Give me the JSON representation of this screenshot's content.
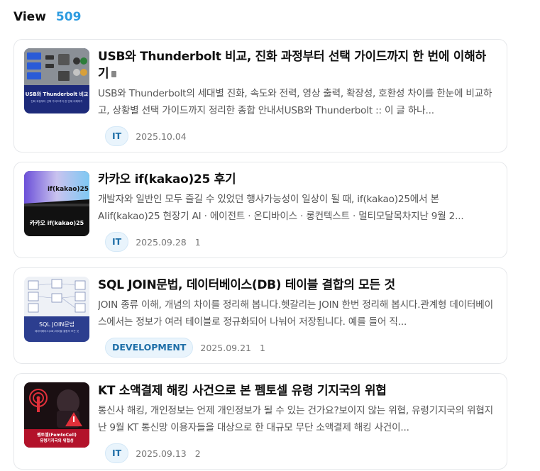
{
  "header": {
    "label": "View",
    "count": "509"
  },
  "posts": [
    {
      "title": "USB와 Thunderbolt 비교, 진화 과정부터 선택 가이드까지 한 번에 이해하기",
      "description": "USB와 Thunderbolt의 세대별 진화, 속도와 전력, 영상 출력, 확장성, 호환성 차이를 한눈에 비교하고, 상황별 선택 가이드까지 정리한 종합 안내서USB와 Thunderbolt :: 이 글 하나...",
      "tag": "IT",
      "date": "2025.10.04",
      "views": "",
      "thumb_text": "USB와 Thunderbolt 비교",
      "thumb_sub": "진화 과정부터 선택 가이드까지 한 번에 이해하기"
    },
    {
      "title": "카카오 if(kakao)25 후기",
      "description": "개발자와 일반인 모두 즐길 수 있었던 행사가능성이 일상이 될 때, if(kakao)25에서 본 AIif(kakao)25 현장기 AI · 에이전트 · 온디바이스 · 롱컨텍스트 · 멀티모달목차지난 9월 2...",
      "tag": "IT",
      "date": "2025.09.28",
      "views": "1",
      "thumb_text": "카카오 if(kakao)25",
      "thumb_sign": "if(kakao)25"
    },
    {
      "title": "SQL JOIN문법, 데이터베이스(DB) 테이블 결합의 모든 것",
      "description": "JOIN 종류 이해, 개념의 차이를 정리해 봅니다.헷갈리는 JOIN 한번 정리해 봅시다.관계형 데이터베이스에서는 정보가 여러 테이블로 정규화되어 나눠어 저장됩니다. 예를 들어 직...",
      "tag": "DEVELOPMENT",
      "date": "2025.09.21",
      "views": "1",
      "thumb_text": "SQL JOIN문법",
      "thumb_sub": "데이터베이스(DB) 테이블 결합의 모든 것"
    },
    {
      "title": "KT 소액결제 해킹 사건으로 본 펨토셀 유령 기지국의 위협",
      "description": "통신사 해킹, 개인정보는 언제 개인정보가 될 수 있는 건가요?보이지 않는 위협, 유령기지국의 위협지난 9월 KT 통신망 이용자들을 대상으로 한 대규모 무단 소액결제 해킹 사건이...",
      "tag": "IT",
      "date": "2025.09.13",
      "views": "2",
      "thumb_text": "펨토셀(FemtoCell)",
      "thumb_sub": "유령기지국의 위협성"
    }
  ],
  "colors": {
    "accent": "#2d9be0",
    "tag_text": "#1f6fa8",
    "tag_bg": "#e9f4fc"
  }
}
